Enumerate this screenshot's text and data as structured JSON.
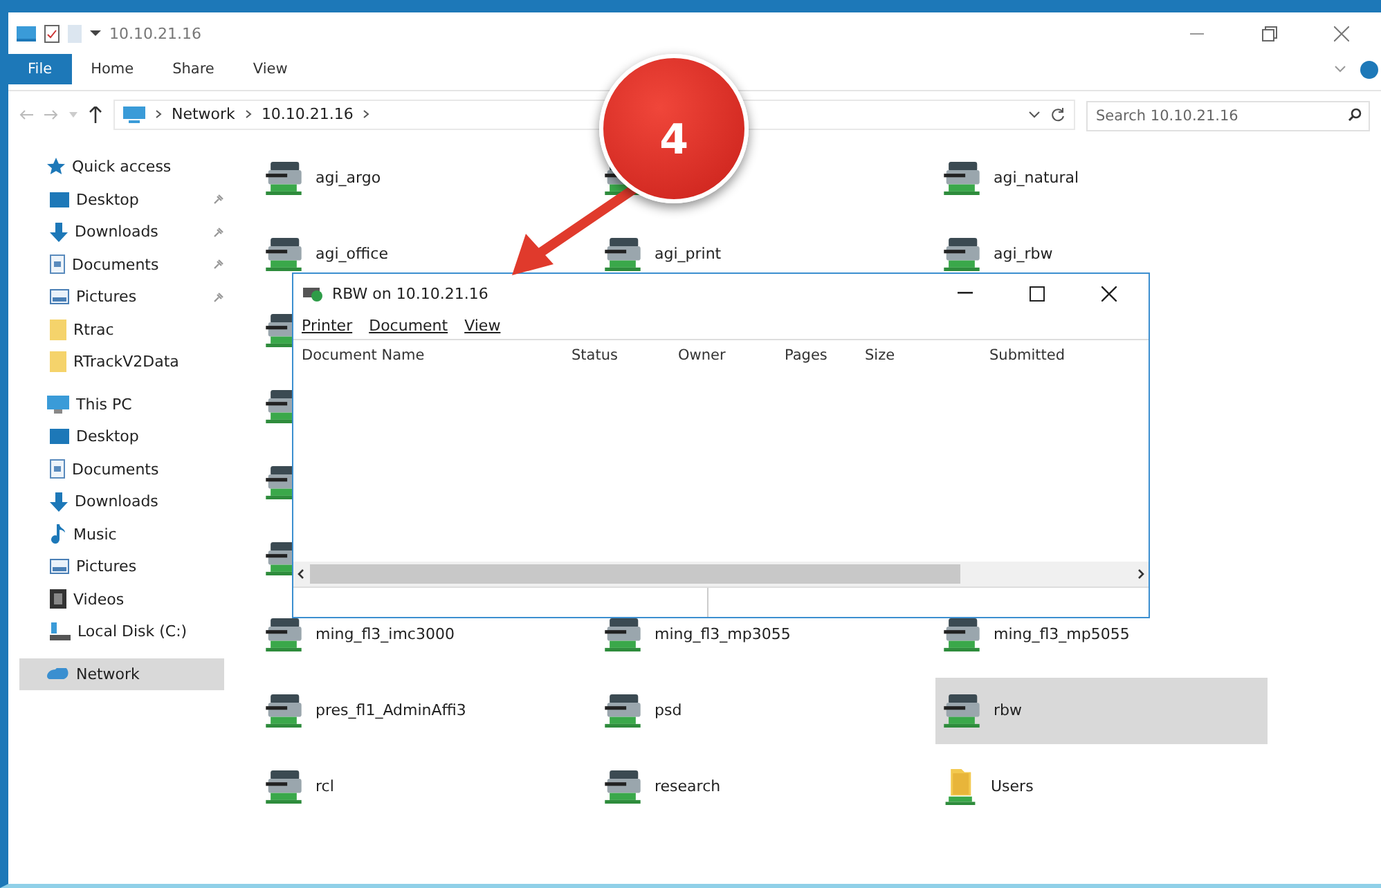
{
  "window": {
    "title": "10.10.21.16"
  },
  "ribbon_tabs": [
    {
      "label": "File",
      "selected": true
    },
    {
      "label": "Home",
      "selected": false
    },
    {
      "label": "Share",
      "selected": false
    },
    {
      "label": "View",
      "selected": false
    }
  ],
  "address": {
    "path": [
      "Network",
      "10.10.21.16"
    ]
  },
  "search": {
    "placeholder": "Search 10.10.21.16"
  },
  "sidebar": {
    "sections": [
      {
        "label": "Quick access",
        "kind": "star",
        "selected": false,
        "children": [
          {
            "label": "Desktop",
            "kind": "desktop",
            "pinned": true,
            "selected": false
          },
          {
            "label": "Downloads",
            "kind": "download",
            "pinned": true,
            "selected": false
          },
          {
            "label": "Documents",
            "kind": "document",
            "pinned": true,
            "selected": false
          },
          {
            "label": "Pictures",
            "kind": "pictures",
            "pinned": true,
            "selected": false
          },
          {
            "label": "Rtrac",
            "kind": "folder",
            "pinned": false,
            "selected": false
          },
          {
            "label": "RTrackV2Data",
            "kind": "folder",
            "pinned": false,
            "selected": false
          }
        ]
      },
      {
        "label": "This PC",
        "kind": "pc",
        "selected": false,
        "children": [
          {
            "label": "Desktop",
            "kind": "desktop",
            "pinned": false,
            "selected": false
          },
          {
            "label": "Documents",
            "kind": "document",
            "pinned": false,
            "selected": false
          },
          {
            "label": "Downloads",
            "kind": "download",
            "pinned": false,
            "selected": false
          },
          {
            "label": "Music",
            "kind": "music",
            "pinned": false,
            "selected": false
          },
          {
            "label": "Pictures",
            "kind": "pictures",
            "pinned": false,
            "selected": false
          },
          {
            "label": "Videos",
            "kind": "videos",
            "pinned": false,
            "selected": false
          },
          {
            "label": "Local Disk (C:)",
            "kind": "disk",
            "pinned": false,
            "selected": false
          }
        ]
      },
      {
        "label": "Network",
        "kind": "network",
        "selected": true
      }
    ]
  },
  "item_rows": [
    [
      {
        "kind": "printer",
        "label": "agi_argo",
        "selected": false
      },
      {
        "kind": "printer",
        "selected": false
      },
      {
        "kind": "printer",
        "label": "agi_natural",
        "selected": false
      }
    ],
    [
      {
        "kind": "printer",
        "label": "agi_office",
        "selected": false
      },
      {
        "kind": "printer",
        "label": "agi_print",
        "selected": false
      },
      {
        "kind": "printer",
        "label": "agi_rbw",
        "selected": false
      }
    ],
    [
      {
        "kind": "printer",
        "selected": false
      }
    ],
    [
      {
        "kind": "printer",
        "selected": false
      }
    ],
    [
      {
        "kind": "printer",
        "selected": false
      }
    ],
    [
      {
        "kind": "printer",
        "selected": false
      }
    ],
    [
      {
        "kind": "printer",
        "label": "ming_fl3_imc3000",
        "selected": false
      },
      {
        "kind": "printer",
        "label": "ming_fl3_mp3055",
        "selected": false
      },
      {
        "kind": "printer",
        "label": "ming_fl3_mp5055",
        "selected": false
      }
    ],
    [
      {
        "kind": "printer",
        "label": "pres_fl1_AdminAffi3",
        "selected": false
      },
      {
        "kind": "printer",
        "label": "psd",
        "selected": false
      },
      {
        "kind": "printer",
        "label": "rbw",
        "selected": true
      }
    ],
    [
      {
        "kind": "printer",
        "label": "rcl",
        "selected": false
      },
      {
        "kind": "printer",
        "label": "research",
        "selected": false
      },
      {
        "kind": "folder",
        "label": "Users",
        "selected": false
      }
    ]
  ],
  "queue_window": {
    "title": "RBW on 10.10.21.16",
    "menu": [
      "Printer",
      "Document",
      "View"
    ],
    "columns": [
      "Document Name",
      "Status",
      "Owner",
      "Pages",
      "Size",
      "Submitted"
    ]
  },
  "callout": {
    "label": "4"
  }
}
